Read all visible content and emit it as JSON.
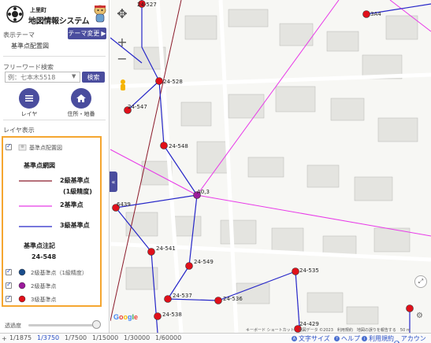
{
  "header": {
    "sub_title": "上里町",
    "app_title": "地図情報システム"
  },
  "theme": {
    "label": "表示テーマ",
    "change_button": "テーマ変更",
    "current": "基準点配置図"
  },
  "search": {
    "label": "フリーワード検索",
    "placeholder": "例：七本木5518",
    "button": "検索"
  },
  "tools": {
    "layer_label": "レイヤ",
    "address_label": "住所・地番"
  },
  "layers": {
    "section_label": "レイヤ表示",
    "main_layer": "基準点配置図",
    "network_title": "基準点網図",
    "lines": [
      {
        "label": "2級基準点",
        "sub": "(1級精度)",
        "color": "#8b1a2a"
      },
      {
        "label": "2基準点",
        "color": "#e83ae8"
      },
      {
        "label": "3級基準点",
        "color": "#2626c8"
      }
    ],
    "annotation_title": "基準点注記",
    "annotation_example": "24-548",
    "points": [
      {
        "label": "2級基準点（1級精度）",
        "color": "#1a4d8c"
      },
      {
        "label": "2級基準点",
        "color": "#9b1a9b"
      },
      {
        "label": "3級基準点",
        "color": "#e0101a"
      }
    ]
  },
  "opacity": {
    "label": "透過度"
  },
  "scales": [
    "1/1875",
    "1/3750",
    "1/7500",
    "1/15000",
    "1/30000",
    "1/60000"
  ],
  "scale_active": "1/3750",
  "map": {
    "zoom_in": "+",
    "zoom_out": "−",
    "point_labels": [
      "24-527",
      "3A4",
      "24-528",
      "24-547",
      "24-548",
      "A0,3",
      "6439",
      "24-541",
      "24-549",
      "24-535",
      "24-537",
      "24-536",
      "24-538",
      "24-429"
    ],
    "google": "Google",
    "attribution": "キーボード ショートカット　地図データ ©2023　利用規約　地図の誤りを報告する　50 m"
  },
  "footer": {
    "font_size": "文字サイズ",
    "help": "ヘルプ",
    "terms": "利用規約",
    "account": "アカウント"
  },
  "colors": {
    "accent": "#4a4d9e",
    "legend_border": "#f5a630",
    "point_red": "#e0101a",
    "point_purple": "#9b1a9b",
    "line_magenta": "#e83ae8",
    "line_blue": "#2626c8",
    "line_darkred": "#8b1a2a"
  }
}
